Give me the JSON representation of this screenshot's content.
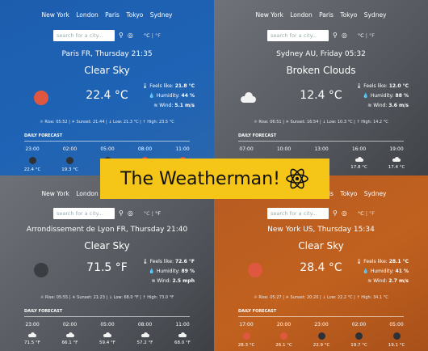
{
  "nav": [
    "New York",
    "London",
    "Paris",
    "Tokyo",
    "Sydney"
  ],
  "search": {
    "placeholder": "search for a city..."
  },
  "units": {
    "celsius": "°C",
    "sep": "|",
    "fahrenheit": "°F"
  },
  "banner": {
    "title": "The Weatherman!",
    "icon": "atom-icon"
  },
  "p1": {
    "city": "Paris FR, Thursday 21:35",
    "condition": "Clear Sky",
    "temp": "22.4 °C",
    "feels": "21.8 °C",
    "humidity": "44 %",
    "wind": "5.1 m/s",
    "sun": "Rise: 05:52 | ☀ Sunset: 21:44 | ↓ Low: 21.3 °C | ↑ High: 23.5 °C",
    "daily": "DAILY FORECAST",
    "forecast": [
      {
        "time": "23:00",
        "temp": "22.4 °C"
      },
      {
        "time": "02:00",
        "temp": "19.3 °C"
      },
      {
        "time": "05:00",
        "temp": ""
      },
      {
        "time": "08:00",
        "temp": ""
      },
      {
        "time": "11:00",
        "temp": ""
      }
    ]
  },
  "p2": {
    "city": "Sydney AU, Friday 05:32",
    "condition": "Broken Clouds",
    "temp": "12.4 °C",
    "feels": "12.0 °C",
    "humidity": "88 %",
    "wind": "3.6 m/s",
    "sun": "Rise: 06:51 | ☀ Sunset: 16:54 | ↓ Low: 10.3 °C | ↑ High: 14.2 °C",
    "daily": "DAILY FORECAST",
    "forecast": [
      {
        "time": "07:00",
        "temp": ""
      },
      {
        "time": "10:00",
        "temp": ""
      },
      {
        "time": "13:00",
        "temp": ""
      },
      {
        "time": "16:00",
        "temp": "17.8 °C"
      },
      {
        "time": "19:00",
        "temp": "17.4 °C"
      }
    ]
  },
  "p3": {
    "city": "Arrondissement de Lyon FR, Thursday 21:40",
    "condition": "Clear Sky",
    "temp": "71.5 °F",
    "feels": "72.6 °F",
    "humidity": "89 %",
    "wind": "2.5 mph",
    "sun": "Rise: 05:55 | ☀ Sunset: 21:23 | ↓ Low: 68.0 °F | ↑ High: 73.0 °F",
    "daily": "DAILY FORECAST",
    "forecast": [
      {
        "time": "23:00",
        "temp": "71.5 °F"
      },
      {
        "time": "02:00",
        "temp": "66.1 °F"
      },
      {
        "time": "05:00",
        "temp": "59.4 °F"
      },
      {
        "time": "08:00",
        "temp": "57.2 °F"
      },
      {
        "time": "11:00",
        "temp": "68.0 °F"
      }
    ]
  },
  "p4": {
    "city": "New York US, Thursday 15:34",
    "condition": "Clear Sky",
    "temp": "28.4 °C",
    "feels": "28.1 °C",
    "humidity": "41 %",
    "wind": "2.7 m/s",
    "sun": "Rise: 05:27 | ☀ Sunset: 20:20 | ↓ Low: 22.2 °C | ↑ High: 34.1 °C",
    "daily": "DAILY FORECAST",
    "forecast": [
      {
        "time": "17:00",
        "temp": "28.3 °C"
      },
      {
        "time": "20:00",
        "temp": "26.1 °C"
      },
      {
        "time": "23:00",
        "temp": "22.9 °C"
      },
      {
        "time": "02:00",
        "temp": "19.7 °C"
      },
      {
        "time": "05:00",
        "temp": "19.1 °C"
      }
    ]
  },
  "labels": {
    "feels": "Feels like:",
    "humidity": "Humidity:",
    "wind": "Wind:"
  },
  "colors": {
    "banner": "#f5c518",
    "sun": "#e0573f"
  }
}
